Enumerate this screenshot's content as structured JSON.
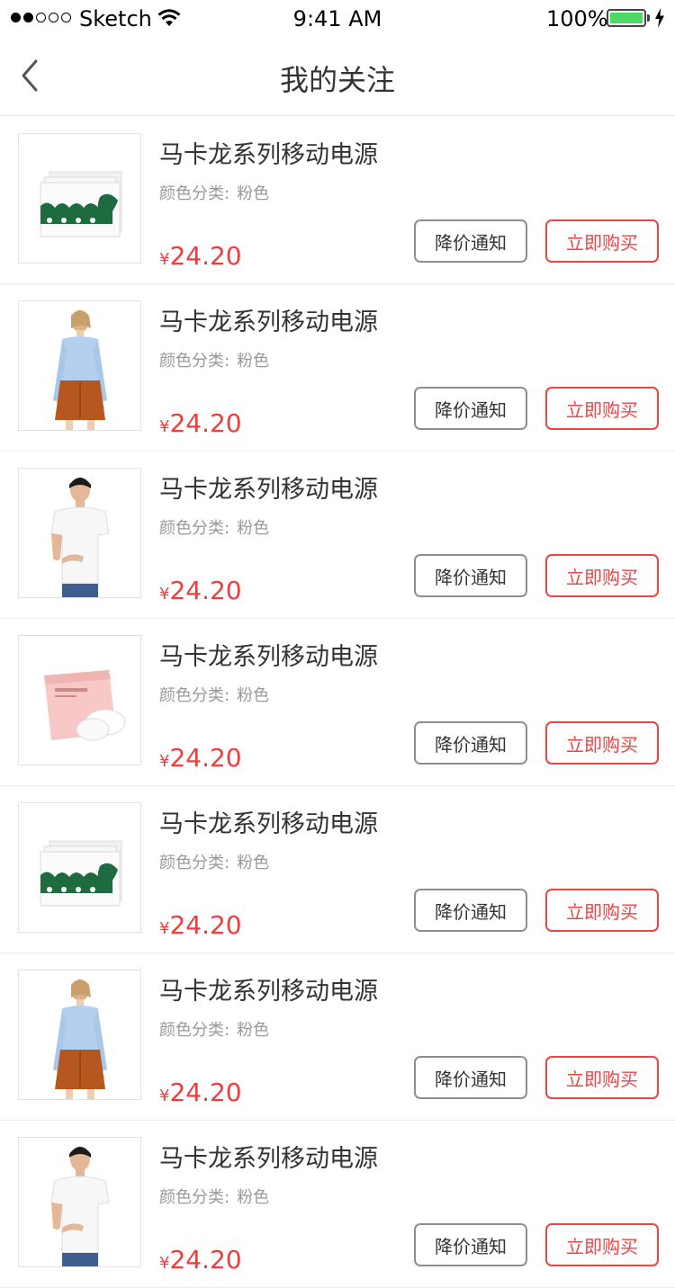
{
  "status_bar": {
    "carrier": "Sketch",
    "time": "9:41 AM",
    "battery": "100%",
    "battery_level": 1.0
  },
  "nav": {
    "title": "我的关注",
    "back_icon": "chevron-left-icon"
  },
  "colors": {
    "price": "#f03c3c",
    "buy_border": "#ef4444",
    "battery": "#4cd964"
  },
  "items": [
    {
      "image": "power-bank-pack",
      "title": "马卡龙系列移动电源",
      "spec_label": "颜色分类:",
      "spec_value": "粉色",
      "currency": "¥",
      "price": "24.20",
      "notify_label": "降价通知",
      "buy_label": "立即购买"
    },
    {
      "image": "woman-blue-top-orange-skirt",
      "title": "马卡龙系列移动电源",
      "spec_label": "颜色分类:",
      "spec_value": "粉色",
      "currency": "¥",
      "price": "24.20",
      "notify_label": "降价通知",
      "buy_label": "立即购买"
    },
    {
      "image": "man-white-tshirt",
      "title": "马卡龙系列移动电源",
      "spec_label": "颜色分类:",
      "spec_value": "粉色",
      "currency": "¥",
      "price": "24.20",
      "notify_label": "降价通知",
      "buy_label": "立即购买"
    },
    {
      "image": "pink-package",
      "title": "马卡龙系列移动电源",
      "spec_label": "颜色分类:",
      "spec_value": "粉色",
      "currency": "¥",
      "price": "24.20",
      "notify_label": "降价通知",
      "buy_label": "立即购买"
    },
    {
      "image": "power-bank-pack",
      "title": "马卡龙系列移动电源",
      "spec_label": "颜色分类:",
      "spec_value": "粉色",
      "currency": "¥",
      "price": "24.20",
      "notify_label": "降价通知",
      "buy_label": "立即购买"
    },
    {
      "image": "woman-blue-top-orange-skirt",
      "title": "马卡龙系列移动电源",
      "spec_label": "颜色分类:",
      "spec_value": "粉色",
      "currency": "¥",
      "price": "24.20",
      "notify_label": "降价通知",
      "buy_label": "立即购买"
    },
    {
      "image": "man-white-tshirt",
      "title": "马卡龙系列移动电源",
      "spec_label": "颜色分类:",
      "spec_value": "粉色",
      "currency": "¥",
      "price": "24.20",
      "notify_label": "降价通知",
      "buy_label": "立即购买"
    }
  ]
}
